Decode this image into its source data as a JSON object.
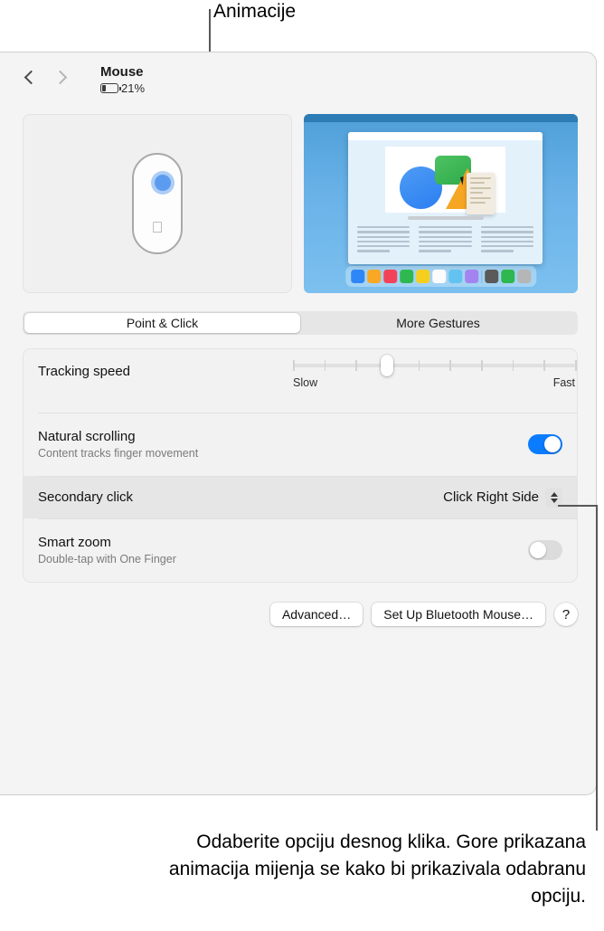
{
  "callouts": {
    "top_label": "Animacije",
    "bottom_text": "Odaberite opciju desnog klika. Gore prikazana animacija mijenja se kako bi prikazivala odabranu opciju."
  },
  "window": {
    "title": "Mouse",
    "battery_percent": "21%",
    "back_icon": "chevron-left-icon",
    "forward_icon": "chevron-right-icon",
    "battery_icon": "battery-low-icon"
  },
  "preview": {
    "mouse_icon": "magic-mouse-illustration",
    "apple_logo": "",
    "click_indicator": "right-side-click-highlight",
    "animation_icon": "desktop-animation-illustration",
    "dock_colors": [
      "#2f86f6",
      "#f9a825",
      "#f2425a",
      "#2eb84f",
      "#f6cf1e",
      "#fbfbfb",
      "#63c3f0",
      "#a383f0",
      "sep",
      "#5a5a5a",
      "#2eb84f",
      "#b6b6b6"
    ]
  },
  "tabs": [
    {
      "label": "Point & Click",
      "active": true
    },
    {
      "label": "More Gestures",
      "active": false
    }
  ],
  "settings": {
    "tracking": {
      "label": "Tracking speed",
      "min_label": "Slow",
      "max_label": "Fast",
      "ticks": 10,
      "value_index": 3
    },
    "natural_scrolling": {
      "label": "Natural scrolling",
      "sublabel": "Content tracks finger movement",
      "state": "on"
    },
    "secondary_click": {
      "label": "Secondary click",
      "value": "Click Right Side",
      "highlighted": true,
      "chevron_icon": "chevron-up-down-icon"
    },
    "smart_zoom": {
      "label": "Smart zoom",
      "sublabel": "Double-tap with One Finger",
      "state": "off"
    }
  },
  "buttons": {
    "advanced": "Advanced…",
    "setup_bluetooth": "Set Up Bluetooth Mouse…",
    "help": "?"
  },
  "colors": {
    "accent": "#0a7cff",
    "window_bg": "#f4f4f4",
    "list_bg": "#f2f2f2",
    "row_highlight": "#e6e6e6"
  }
}
